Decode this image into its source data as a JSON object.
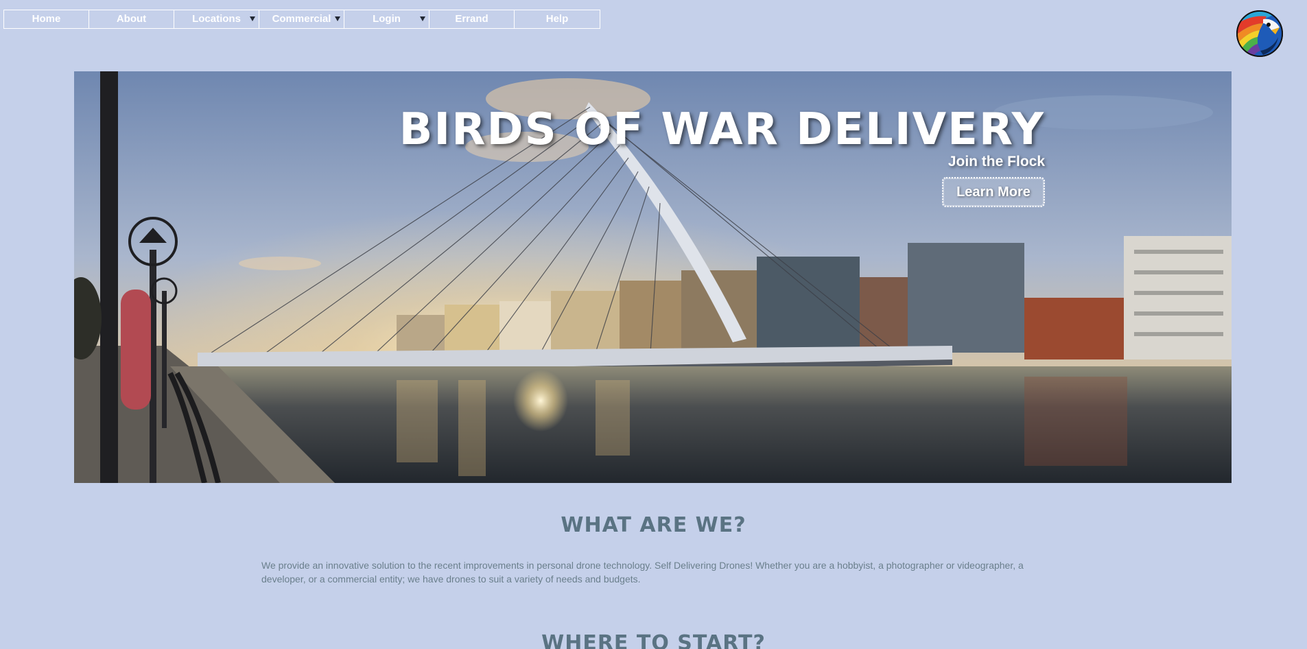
{
  "nav": {
    "items": [
      {
        "label": "Home",
        "dropdown": false
      },
      {
        "label": "About",
        "dropdown": false
      },
      {
        "label": "Locations",
        "dropdown": true
      },
      {
        "label": "Commercial",
        "dropdown": true
      },
      {
        "label": "Login",
        "dropdown": true
      },
      {
        "label": "Errand",
        "dropdown": false
      },
      {
        "label": "Help",
        "dropdown": false
      }
    ]
  },
  "logo": {
    "icon": "rainbow-bird-logo-icon"
  },
  "hero": {
    "title": "BIRDS OF WAR DELIVERY",
    "subtitle": "Join the Flock",
    "button_label": "Learn More",
    "image": "bridge-river-sunset-photo"
  },
  "sections": {
    "what_title": "WHAT ARE WE?",
    "what_text": "We provide an innovative solution to the recent improvements in personal drone technology. Self Delivering Drones! Whether you are a hobbyist, a photographer or videographer, a developer, or a commercial entity; we have drones to suit a variety of needs and budgets.",
    "where_title": "WHERE TO START?"
  },
  "colors": {
    "page_bg": "#c5d0ea",
    "heading": "#5a7383",
    "body_text": "#6a7f8c",
    "nav_text": "#ffffff"
  }
}
